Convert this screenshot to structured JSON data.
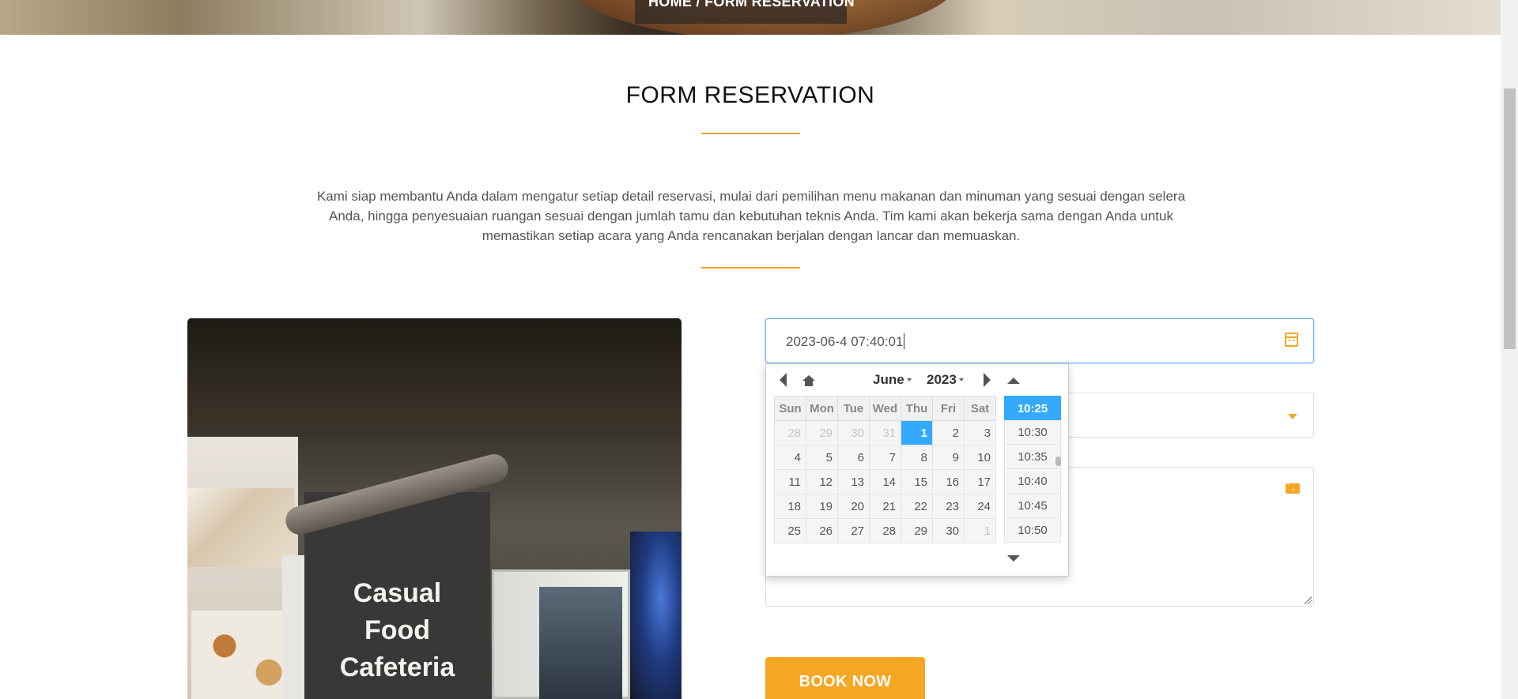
{
  "breadcrumb": {
    "home": "HOME",
    "separator": "/",
    "current": "FORM RESERVATION"
  },
  "section": {
    "title": "FORM RESERVATION",
    "intro": "Kami siap membantu Anda dalam mengatur setiap detail reservasi, mulai dari pemilihan menu makanan dan minuman yang sesuai dengan selera Anda, hingga penyesuaian ruangan sesuai dengan jumlah tamu dan kebutuhan teknis Anda. Tim kami akan bekerja sama dengan Anda untuk memastikan setiap acara yang Anda rencanakan berjalan dengan lancar dan memuaskan."
  },
  "photo": {
    "sign_text": "Casual Food Cafeteria"
  },
  "form": {
    "datetime_value": "2023-06-4 07:40:01",
    "book_button": "BOOK NOW"
  },
  "picker": {
    "month": "June",
    "year": "2023",
    "weekdays": [
      "Sun",
      "Mon",
      "Tue",
      "Wed",
      "Thu",
      "Fri",
      "Sat"
    ],
    "weeks": [
      [
        "28",
        "29",
        "30",
        "31",
        "1",
        "2",
        "3"
      ],
      [
        "4",
        "5",
        "6",
        "7",
        "8",
        "9",
        "10"
      ],
      [
        "11",
        "12",
        "13",
        "14",
        "15",
        "16",
        "17"
      ],
      [
        "18",
        "19",
        "20",
        "21",
        "22",
        "23",
        "24"
      ],
      [
        "25",
        "26",
        "27",
        "28",
        "29",
        "30",
        "1"
      ]
    ],
    "times": [
      "10:25",
      "10:30",
      "10:35",
      "10:40",
      "10:45",
      "10:50"
    ],
    "selected_time": "10:25"
  },
  "colors": {
    "accent": "#f5a623",
    "picker_selected": "#33aaff",
    "input_focus": "#6aaef0"
  }
}
